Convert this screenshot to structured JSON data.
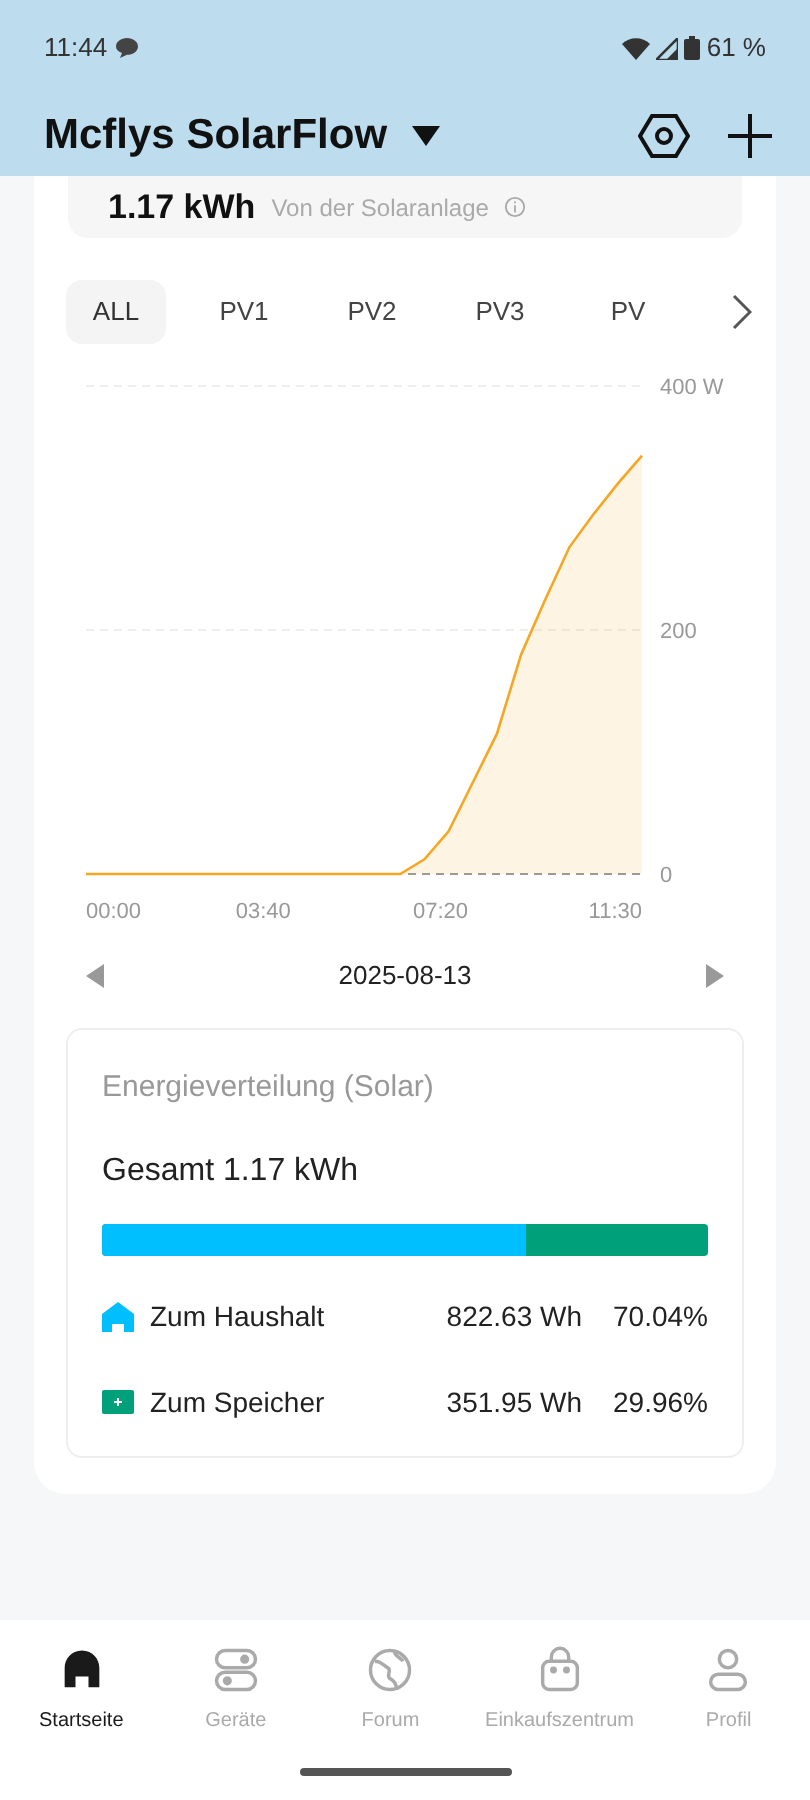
{
  "status_bar": {
    "time": "11:44",
    "battery": "61 %"
  },
  "header": {
    "title": "Mcflys SolarFlow"
  },
  "summary": {
    "value": "1.17 kWh",
    "label": "Von der Solaranlage"
  },
  "tabs": [
    {
      "label": "ALL",
      "selected": true
    },
    {
      "label": "PV1",
      "selected": false
    },
    {
      "label": "PV2",
      "selected": false
    },
    {
      "label": "PV3",
      "selected": false
    },
    {
      "label": "PV",
      "selected": false
    }
  ],
  "chart": {
    "chart_data": {
      "type": "area",
      "x": [
        0,
        390,
        420,
        450,
        480,
        510,
        540,
        570,
        600,
        630,
        660,
        690
      ],
      "xlim": [
        0,
        690
      ],
      "ylim": [
        0,
        400
      ],
      "xticks": [
        {
          "value": 0,
          "label": "00:00"
        },
        {
          "value": 220,
          "label": "03:40"
        },
        {
          "value": 440,
          "label": "07:20"
        },
        {
          "value": 690,
          "label": "11:30"
        }
      ],
      "yticks": [
        {
          "value": 0,
          "label": "0"
        },
        {
          "value": 200,
          "label": "200"
        },
        {
          "value": 400,
          "label": "400 W"
        }
      ],
      "series": [
        {
          "color": "#f5a623",
          "values": [
            0,
            0,
            12,
            35,
            75,
            115,
            180,
            225,
            268,
            295,
            320,
            343
          ]
        }
      ]
    }
  },
  "date": "2025-08-13",
  "distribution": {
    "title": "Energieverteilung (Solar)",
    "total": "Gesamt 1.17 kWh",
    "items": [
      {
        "kind": "household",
        "label": "Zum Haushalt",
        "energy": "822.63 Wh",
        "percent": "70.04%",
        "color": "#00bfff",
        "level": 0.7004
      },
      {
        "kind": "storage",
        "label": "Zum Speicher",
        "energy": "351.95 Wh",
        "percent": "29.96%",
        "color": "#00a07a"
      }
    ]
  },
  "nav": [
    {
      "label": "Startseite",
      "selected": true
    },
    {
      "label": "Geräte",
      "selected": false
    },
    {
      "label": "Forum",
      "selected": false
    },
    {
      "label": "Einkaufszentrum",
      "selected": false
    },
    {
      "label": "Profil",
      "selected": false
    }
  ]
}
